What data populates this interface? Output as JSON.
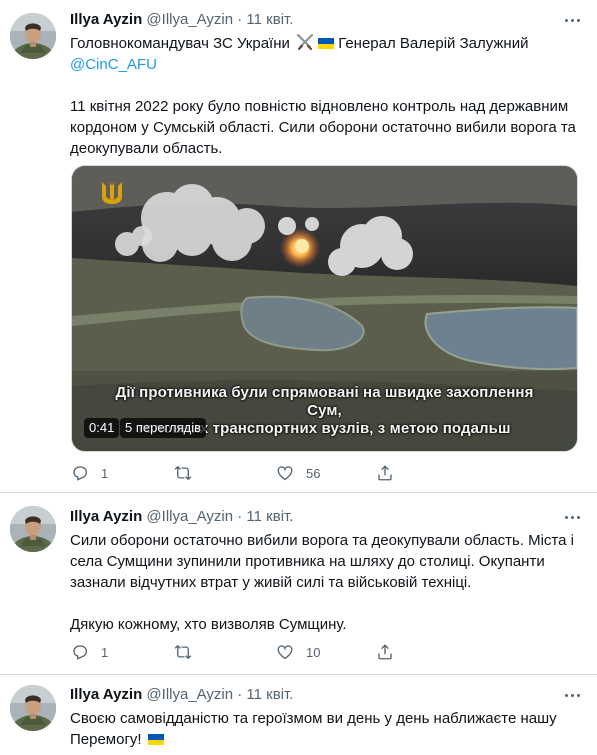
{
  "tweets": [
    {
      "author_name": "Illya Ayzin",
      "author_handle": "@Illya_Ayzin",
      "separator": "·",
      "time": "11 квіт.",
      "line1": "Головнокомандувач ЗС України",
      "line1_tail": "Генерал Валерій Залужний",
      "mention": "@CinC_AFU",
      "body": "11 квітня 2022 року було повністю відновлено контроль над державним кордоном у Сумській області. Сили оборони остаточно вибили ворога та деокупували область.",
      "video": {
        "caption_line1": "Дії противника були спрямовані на швидке захоплення Сум,",
        "caption_line2": "головних транспортних вузлів, з метою подальш",
        "duration": "0:41",
        "views": "5 переглядів"
      },
      "replies": "1",
      "retweets": "",
      "likes": "56"
    },
    {
      "author_name": "Illya Ayzin",
      "author_handle": "@Illya_Ayzin",
      "separator": "·",
      "time": "11 квіт.",
      "body": "Сили оборони остаточно вибили ворога та деокупували область. Міста і села Сумщини зупинили противника на шляху до столиці. Окупанти зазнали відчутних втрат у живій силі та військовій техніці.\n\nДякую кожному, хто визволяв Сумщину.",
      "replies": "1",
      "retweets": "",
      "likes": "10"
    },
    {
      "author_name": "Illya Ayzin",
      "author_handle": "@Illya_Ayzin",
      "separator": "·",
      "time": "11 квіт.",
      "body": "Своєю самовідданістю та героїзмом ви день у день наближаєте нашу Перемогу!"
    }
  ],
  "icons": {
    "reply": "reply-icon",
    "retweet": "retweet-icon",
    "like": "like-icon",
    "share": "share-icon",
    "more": "more-icon",
    "flag": "ukraine-flag-icon",
    "swords": "crossed-swords-icon",
    "trident": "trident-icon"
  },
  "colors": {
    "link": "#1d9bf0",
    "text": "#0f1419",
    "secondary": "#536471",
    "divider": "#cfd9de",
    "flag_blue": "#0057b7",
    "flag_yellow": "#ffd700"
  }
}
